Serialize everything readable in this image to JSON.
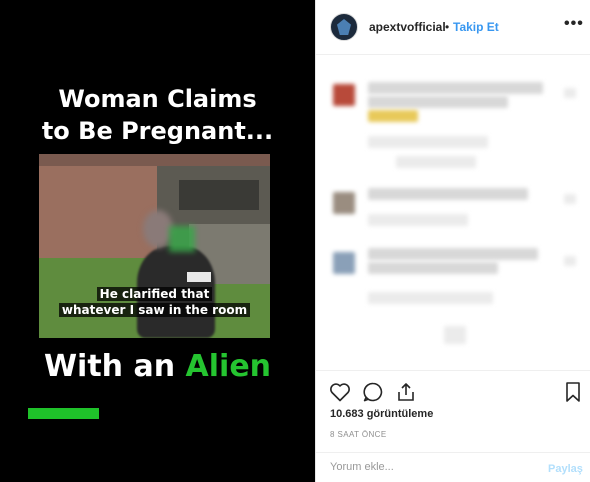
{
  "media": {
    "headline_line1": "Woman Claims",
    "headline_line2": "to Be Pregnant...",
    "subtitle_line1": "He clarified that",
    "subtitle_line2": "whatever I saw in the room",
    "tagline_prefix": "With an ",
    "tagline_accent": "Alien",
    "accent_color": "#25c430"
  },
  "post": {
    "username": "apextvofficial",
    "separator": "•",
    "follow_label": "Takip Et",
    "more_label": "•••",
    "like_icon": "heart-icon",
    "comment_icon": "comment-bubble-icon",
    "share_icon": "share-icon",
    "save_icon": "bookmark-icon",
    "views_text": "10.683 görüntüleme",
    "timestamp": "8 SAAT ÖNCE",
    "comment_placeholder": "Yorum ekle...",
    "post_label": "Paylaş",
    "link_color": "#3897f0"
  }
}
